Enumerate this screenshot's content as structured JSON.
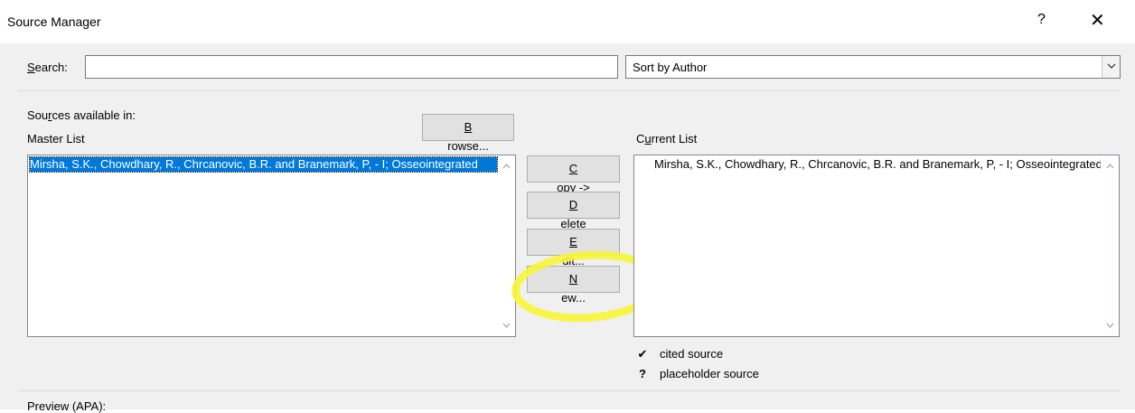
{
  "window": {
    "title": "Source Manager",
    "help_glyph": "?",
    "close_glyph": "✕"
  },
  "search": {
    "label_prefix": "",
    "label_accel": "S",
    "label_rest": "earch:",
    "value": "",
    "placeholder": ""
  },
  "sort": {
    "selected": "Sort by Author",
    "dropdown_icon": "chevron-down-icon"
  },
  "master": {
    "label_line1_a": "Sou",
    "label_line1_accel": "r",
    "label_line1_b": "ces available in:",
    "label_line2": "Master List",
    "browse_accel": "B",
    "browse_rest": "rowse...",
    "items": [
      "Mirsha, S.K., Chowdhary, R., Chrcanovic, B.R. and Branemark, P, - I; Osseointegrated"
    ]
  },
  "actions": {
    "copy_accel": "C",
    "copy_rest": "opy ->",
    "delete_accel": "D",
    "delete_rest": "elete",
    "edit_accel": "E",
    "edit_rest": "dit...",
    "new_accel": "N",
    "new_rest": "ew..."
  },
  "current": {
    "label_a": "C",
    "label_accel": "u",
    "label_b": "rrent List",
    "items": [
      "Mirsha, S.K., Chowdhary, R., Chrcanovic, B.R. and Branemark, P, - I; Osseointegrated"
    ]
  },
  "legend": [
    {
      "symbol": "✔",
      "text": "cited source"
    },
    {
      "symbol": "?",
      "text": "placeholder source"
    }
  ],
  "preview_label": "Preview (APA):",
  "colors": {
    "selection": "#0078d7",
    "highlight": "#f7f53a",
    "dialog_bg": "#f0f0f0"
  }
}
